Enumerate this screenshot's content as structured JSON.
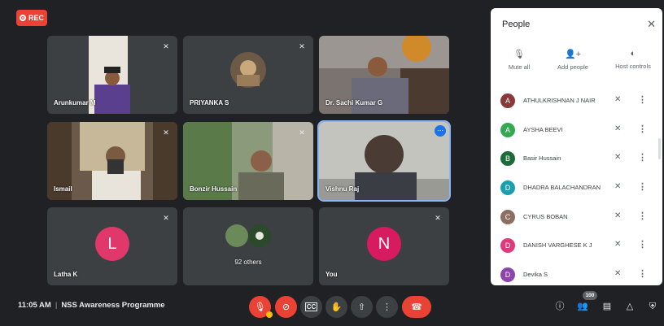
{
  "rec_label": "REC",
  "tiles": [
    {
      "name": "Arunkumar M",
      "avatar_letter": "",
      "avatar_color": "#5b4a88"
    },
    {
      "name": "PRIYANKA S",
      "avatar_letter": "",
      "avatar_color": "#6d5a46"
    },
    {
      "name": "Dr. Sachi Kumar G",
      "avatar_letter": "",
      "avatar_color": "#6c6a6a"
    },
    {
      "name": "Ismail",
      "avatar_letter": "",
      "avatar_color": "#7a6350"
    },
    {
      "name": "Bonzir Hussain",
      "avatar_letter": "",
      "avatar_color": "#7b8a6a"
    },
    {
      "name": "Vishnu Raj",
      "avatar_letter": "",
      "avatar_color": "#4a4e52"
    },
    {
      "name": "Latha K",
      "avatar_letter": "L",
      "avatar_color": "#e0386a"
    },
    {
      "name": "92 others",
      "avatar_letter": "",
      "avatar_color": ""
    },
    {
      "name": "You",
      "avatar_letter": "N",
      "avatar_color": "#d81b60"
    }
  ],
  "bottom": {
    "time": "11:05 AM",
    "separator": "|",
    "meeting_title": "NSS Awareness Programme",
    "participant_count": "100"
  },
  "panel": {
    "title": "People",
    "actions": [
      {
        "label": "Mute all",
        "icon": "mic-off-icon"
      },
      {
        "label": "Add people",
        "icon": "add-person-icon"
      },
      {
        "label": "Host controls",
        "icon": "toggle-icon"
      }
    ],
    "people": [
      {
        "initial": "A",
        "name": "ATHULKRISHNAN J NAIR",
        "color": "#8b3a3a"
      },
      {
        "initial": "A",
        "name": "AYSHA BEEVI",
        "color": "#34a853"
      },
      {
        "initial": "B",
        "name": "Basir Hussain",
        "color": "#1e6b3a"
      },
      {
        "initial": "D",
        "name": "DHADRA BALACHANDRAN",
        "color": "#1a9fb0"
      },
      {
        "initial": "C",
        "name": "CYRUS BOBAN",
        "color": "#8d6e63"
      },
      {
        "initial": "D",
        "name": "DANISH VARGHESE K J",
        "color": "#e0387a"
      },
      {
        "initial": "D",
        "name": "Devika S",
        "color": "#8e44ad"
      }
    ]
  },
  "colors": {
    "background": "#202124",
    "accent_red": "#ea4335",
    "accent_blue": "#1a73e8"
  }
}
